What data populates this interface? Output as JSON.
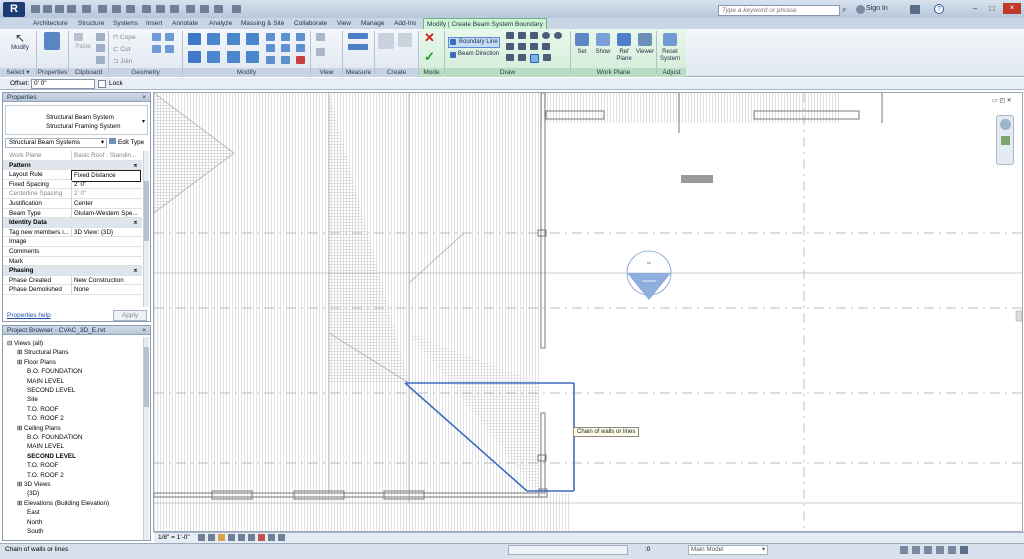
{
  "app": {
    "logo": "R"
  },
  "search": {
    "placeholder": "Type a keyword or phrase"
  },
  "user": {
    "sign_in": "Sign In"
  },
  "tabs": [
    "Architecture",
    "Structure",
    "Systems",
    "Insert",
    "Annotate",
    "Analyze",
    "Massing & Site",
    "Collaborate",
    "View",
    "Manage",
    "Add-Ins",
    "Modify | Create Beam System Boundary"
  ],
  "ribbon": {
    "modify": "Modify",
    "properties": "Properties",
    "paste": "Paste",
    "cope": "Cope",
    "cut": "Cut",
    "join": "Join",
    "boundary_line": "Boundary Line",
    "beam_direction": "Beam Direction",
    "set": "Set",
    "show": "Show",
    "ref_plane": "Ref Plane",
    "viewer": "Viewer",
    "reset_system": "Reset System",
    "panels": {
      "select": "Select ▾",
      "properties": "Properties",
      "clipboard": "Clipboard",
      "geometry": "Geometry",
      "modify": "Modify",
      "view": "View",
      "measure": "Measure",
      "create": "Create",
      "mode": "Mode",
      "draw": "Draw",
      "work_plane": "Work Plane",
      "adjust": "Adjust"
    }
  },
  "options": {
    "offset_label": "Offset:",
    "offset_value": "0'  0\"",
    "lock_label": "Lock"
  },
  "properties": {
    "title": "Properties",
    "type_line1": "Structural Beam System",
    "type_line2": "Structural Framing System",
    "selector": "Structural Beam Systems",
    "edit_type": "Edit Type",
    "rows": [
      {
        "k": "Work Plane",
        "v": "Basic Roof : Standin...",
        "style": "dim"
      },
      {
        "k": "Pattern",
        "v": "",
        "style": "grp"
      },
      {
        "k": "Layout Rule",
        "v": "Fixed Distance",
        "style": ""
      },
      {
        "k": "Fixed Spacing",
        "v": "2'  0\"",
        "style": ""
      },
      {
        "k": "Centerline Spacing",
        "v": "2'  0\"",
        "style": "dim"
      },
      {
        "k": "Justification",
        "v": "Center",
        "style": ""
      },
      {
        "k": "Beam Type",
        "v": "Glulam-Western Spe...",
        "style": ""
      },
      {
        "k": "Identity Data",
        "v": "",
        "style": "grp"
      },
      {
        "k": "Tag new members i...",
        "v": "3D View: {3D}",
        "style": ""
      },
      {
        "k": "Image",
        "v": "",
        "style": ""
      },
      {
        "k": "Comments",
        "v": "",
        "style": ""
      },
      {
        "k": "Mark",
        "v": "",
        "style": ""
      },
      {
        "k": "Phasing",
        "v": "",
        "style": "grp"
      },
      {
        "k": "Phase Created",
        "v": "New Construction",
        "style": ""
      },
      {
        "k": "Phase Demolished",
        "v": "None",
        "style": ""
      }
    ],
    "help": "Properties help",
    "apply": "Apply"
  },
  "browser": {
    "title": "Project Browser - CVAC_3D_E.rvt",
    "items": [
      {
        "t": "Views (all)",
        "l": 0
      },
      {
        "t": "Structural Plans",
        "l": 1
      },
      {
        "t": "Floor Plans",
        "l": 1
      },
      {
        "t": "B.O. FOUNDATION",
        "l": 2
      },
      {
        "t": "MAIN LEVEL",
        "l": 2
      },
      {
        "t": "SECOND LEVEL",
        "l": 2
      },
      {
        "t": "Site",
        "l": 2
      },
      {
        "t": "T.O. ROOF",
        "l": 2
      },
      {
        "t": "T.O. ROOF 2",
        "l": 2
      },
      {
        "t": "Ceiling Plans",
        "l": 1
      },
      {
        "t": "B.O. FOUNDATION",
        "l": 2
      },
      {
        "t": "MAIN LEVEL",
        "l": 2
      },
      {
        "t": "SECOND LEVEL",
        "l": 2,
        "bold": true
      },
      {
        "t": "T.O. ROOF",
        "l": 2
      },
      {
        "t": "T.O. ROOF 2",
        "l": 2
      },
      {
        "t": "3D Views",
        "l": 1
      },
      {
        "t": "{3D}",
        "l": 2
      },
      {
        "t": "Elevations (Building Elevation)",
        "l": 1
      },
      {
        "t": "East",
        "l": 2
      },
      {
        "t": "North",
        "l": 2
      },
      {
        "t": "South",
        "l": 2
      }
    ]
  },
  "view_bar": {
    "scale": "1/8\" = 1'-0\""
  },
  "canvas": {
    "tooltip": "Chain of walls or lines"
  },
  "status": {
    "text": "Chain of walls or lines",
    "coord": ":0",
    "model": "Main Model"
  },
  "colors": {
    "accent": "#3d6dbf",
    "context_tab": "#cff3d6"
  }
}
